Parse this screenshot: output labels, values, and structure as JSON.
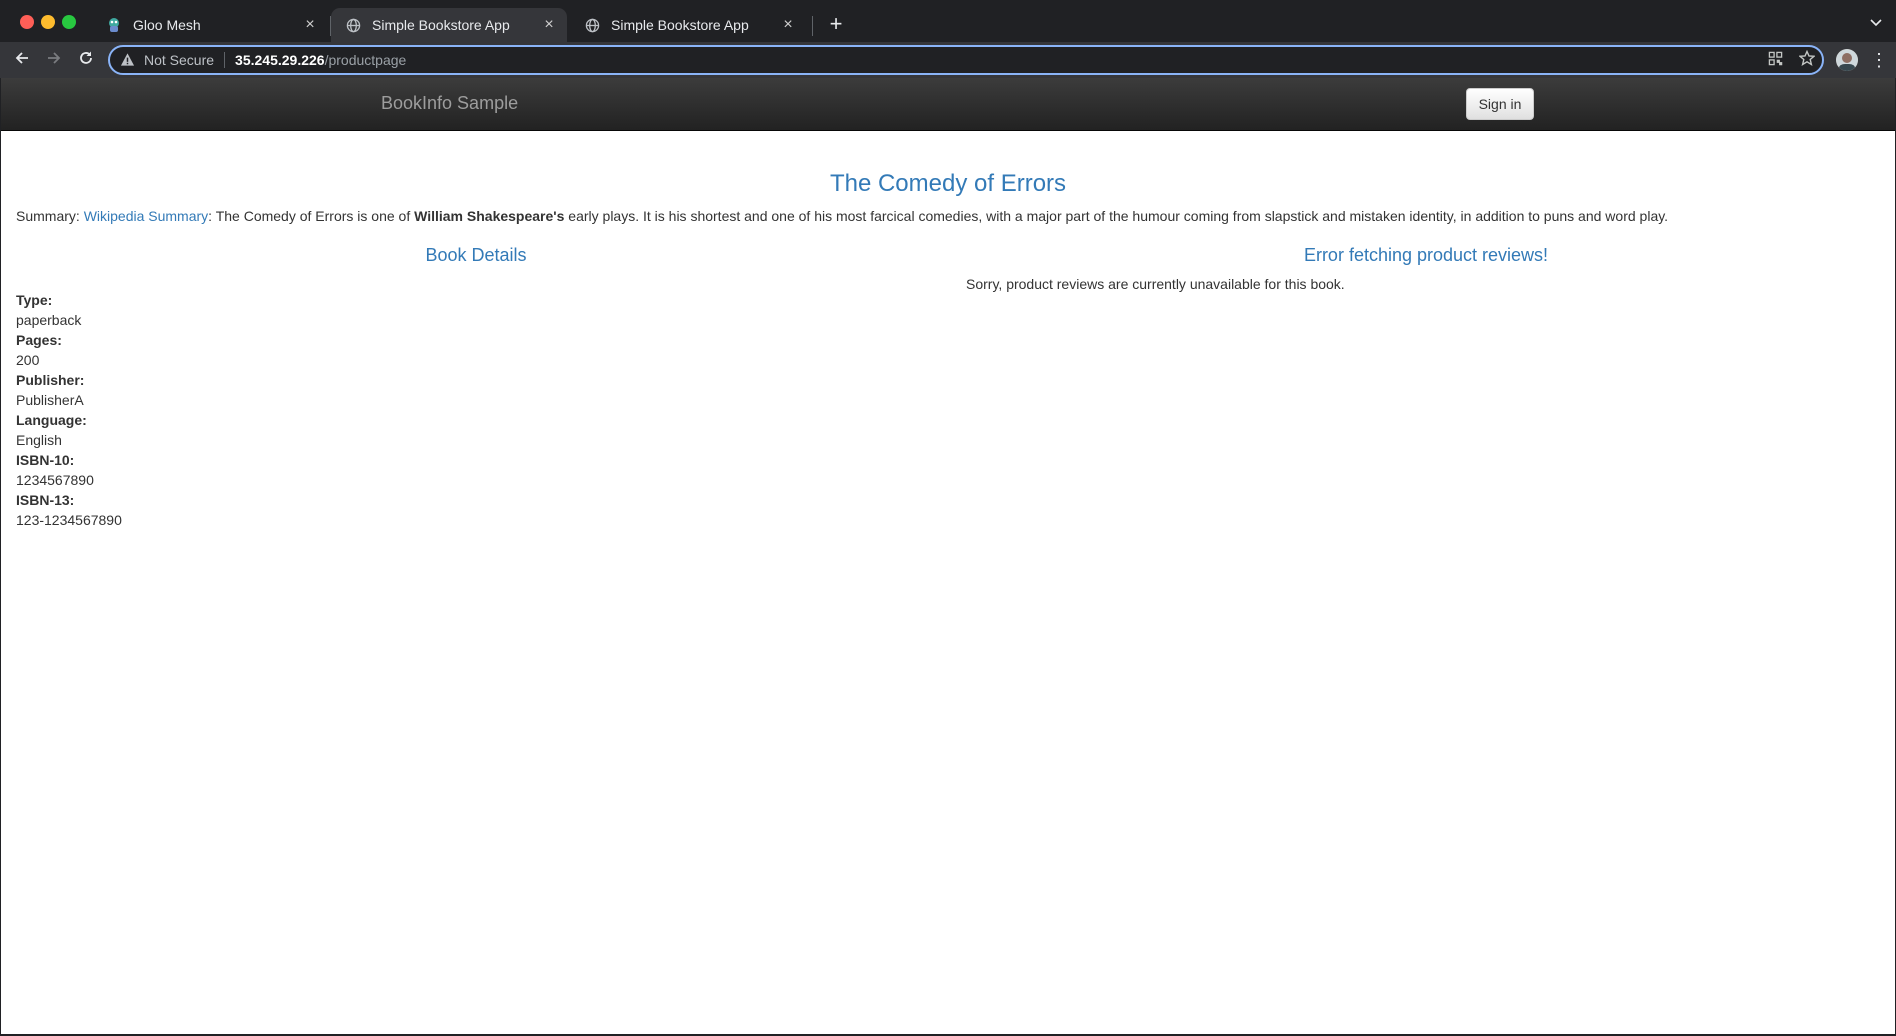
{
  "browser": {
    "tabs": [
      {
        "title": "Gloo Mesh",
        "icon": "gloo-mesh-favicon-icon",
        "active": false
      },
      {
        "title": "Simple Bookstore App",
        "icon": "globe-icon",
        "active": true
      },
      {
        "title": "Simple Bookstore App",
        "icon": "globe-icon",
        "active": false
      }
    ],
    "address": {
      "security_label": "Not Secure",
      "host": "35.245.29.226",
      "path": "/productpage"
    },
    "colors": {
      "focus_ring": "#8ab4f8",
      "frame": "#202124",
      "toolbar": "#35363a"
    }
  },
  "app": {
    "brand": "BookInfo Sample",
    "signin_label": "Sign in",
    "title": "The Comedy of Errors",
    "summary": {
      "prefix": "Summary: ",
      "link_text": "Wikipedia Summary",
      "text_before_bold": ": The Comedy of Errors is one of ",
      "bold": "William Shakespeare's",
      "text_after_bold": " early plays. It is his shortest and one of his most farcical comedies, with a major part of the humour coming from slapstick and mistaken identity, in addition to puns and word play."
    },
    "details_heading": "Book Details",
    "details": [
      {
        "label": "Type:",
        "value": "paperback"
      },
      {
        "label": "Pages:",
        "value": "200"
      },
      {
        "label": "Publisher:",
        "value": "PublisherA"
      },
      {
        "label": "Language:",
        "value": "English"
      },
      {
        "label": "ISBN-10:",
        "value": "1234567890"
      },
      {
        "label": "ISBN-13:",
        "value": "123-1234567890"
      }
    ],
    "reviews_heading": "Error fetching product reviews!",
    "reviews_message": "Sorry, product reviews are currently unavailable for this book.",
    "colors": {
      "link": "#337ab7",
      "text": "#333333"
    }
  }
}
